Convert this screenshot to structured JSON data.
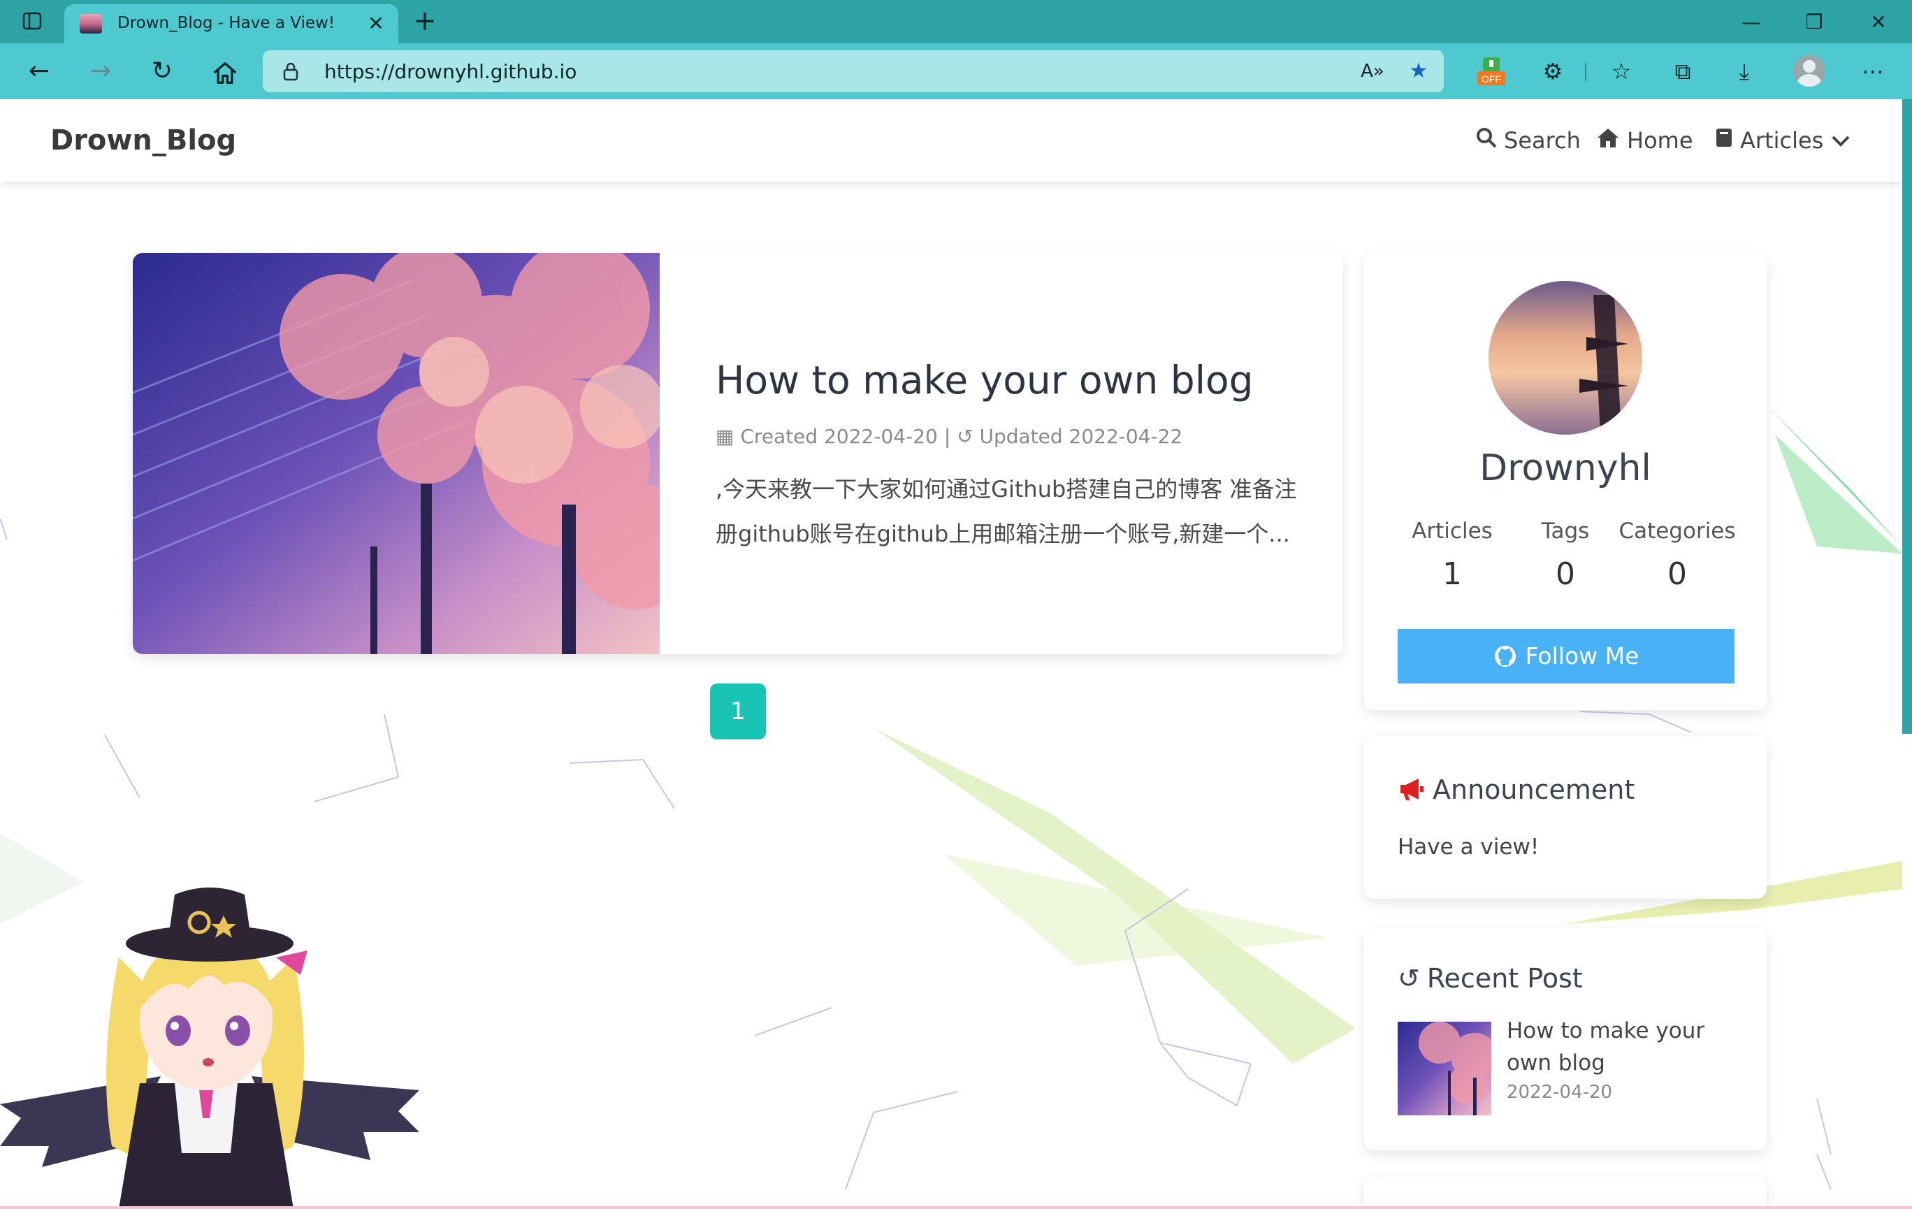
{
  "browser": {
    "tab_title": "Drown_Blog - Have a View!",
    "url": "https://drownyhl.github.io",
    "extension_badge": "OFF",
    "icons": {
      "back": "back-arrow-icon",
      "forward": "forward-arrow-icon",
      "refresh": "refresh-icon",
      "home": "home-icon",
      "read_aloud": "read-aloud-icon",
      "favorite": "star-icon",
      "extensions": "puzzle-icon",
      "favorites": "favorites-icon",
      "collections": "collections-icon",
      "downloads": "download-icon",
      "more": "more-icon"
    }
  },
  "site": {
    "brand": "Drown_Blog",
    "menu": {
      "search": "Search",
      "home": "Home",
      "articles": "Articles"
    }
  },
  "post": {
    "title": "How to make your own blog",
    "created_label": "Created",
    "created": "2022-04-20",
    "separator": "|",
    "updated_label": "Updated",
    "updated": "2022-04-22",
    "excerpt": ",今天来教一下大家如何通过Github搭建自己的博客 准备注册github账号在github上用邮箱注册一个账号,新建一个..."
  },
  "pagination": {
    "current": "1"
  },
  "profile": {
    "name": "Drownyhl",
    "stats": [
      {
        "label": "Articles",
        "value": "1"
      },
      {
        "label": "Tags",
        "value": "0"
      },
      {
        "label": "Categories",
        "value": "0"
      }
    ],
    "follow_label": "Follow Me"
  },
  "announcement": {
    "title": "Announcement",
    "text": "Have a view!"
  },
  "recent": {
    "title": "Recent Post",
    "items": [
      {
        "title": "How to make your own blog",
        "date": "2022-04-20"
      }
    ]
  },
  "colors": {
    "titlebar": "#2ea4a6",
    "toolbar": "#4fc9d0",
    "accent_teal": "#19c4b4",
    "follow_blue": "#49b1f5",
    "announcement_icon": "#e02020"
  }
}
